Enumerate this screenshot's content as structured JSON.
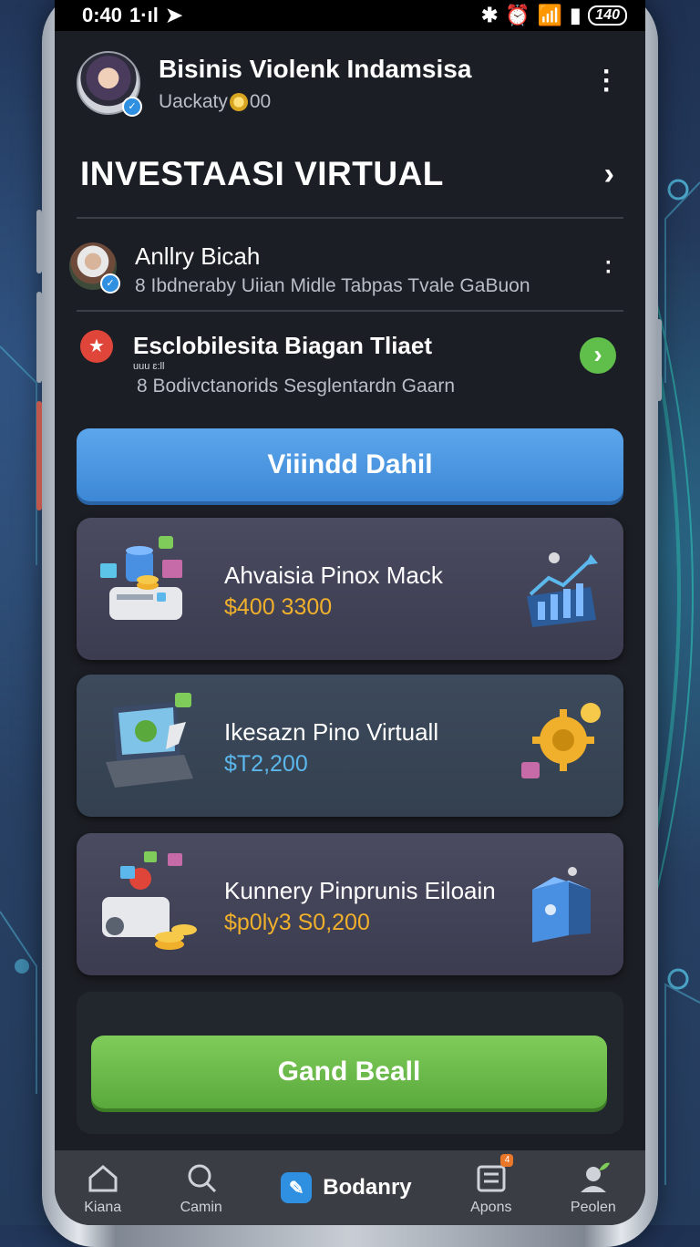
{
  "statusbar": {
    "time": "0:40",
    "left_extra": "1·ıl",
    "battery": "140"
  },
  "profile": {
    "name": "Bisinis Violenk Indamsisa",
    "subtitle_prefix": "Uackaty",
    "subtitle_suffix": "00"
  },
  "section": {
    "title": "INVESTAASI VIRTUAL"
  },
  "rows": [
    {
      "title": "Anllry Bicah",
      "subtitle": "8 Ibdneraby Uiian Midle Tabpas Tvale GaBuon"
    },
    {
      "title": "Esclobilesita Biagan Tliaet",
      "tiny": "uuu ɛ:ll",
      "subtitle": "8 Bodivctanorids Sesglentardn Gaarn"
    }
  ],
  "buttons": {
    "primary": "Viiindd Dahil",
    "secondary": "Gand Beall"
  },
  "cards": [
    {
      "title": "Ahvaisia Pinox Mack",
      "price": "$400 3300",
      "price_color": "#f0b02c"
    },
    {
      "title": "Ikesazn Pino Virtuall",
      "price": "$T2,200",
      "price_color": "#5cb7ec"
    },
    {
      "title": "Kunnery Pinprunis Eiloain",
      "price": "$p0ly3 S0,200",
      "price_color": "#f0b02c"
    }
  ],
  "nav": [
    {
      "label": "Kiana",
      "icon": "home-icon"
    },
    {
      "label": "Camin",
      "icon": "search-icon"
    },
    {
      "label": "Bodanry",
      "icon": "edit-icon",
      "active": true
    },
    {
      "label": "Apons",
      "icon": "list-icon",
      "badge": "4"
    },
    {
      "label": "Peolen",
      "icon": "profile-icon"
    }
  ],
  "colors": {
    "accent_blue": "#3d88d6",
    "accent_green": "#5aa93c",
    "price_gold": "#f0b02c",
    "screen_bg": "#1b1e24"
  }
}
